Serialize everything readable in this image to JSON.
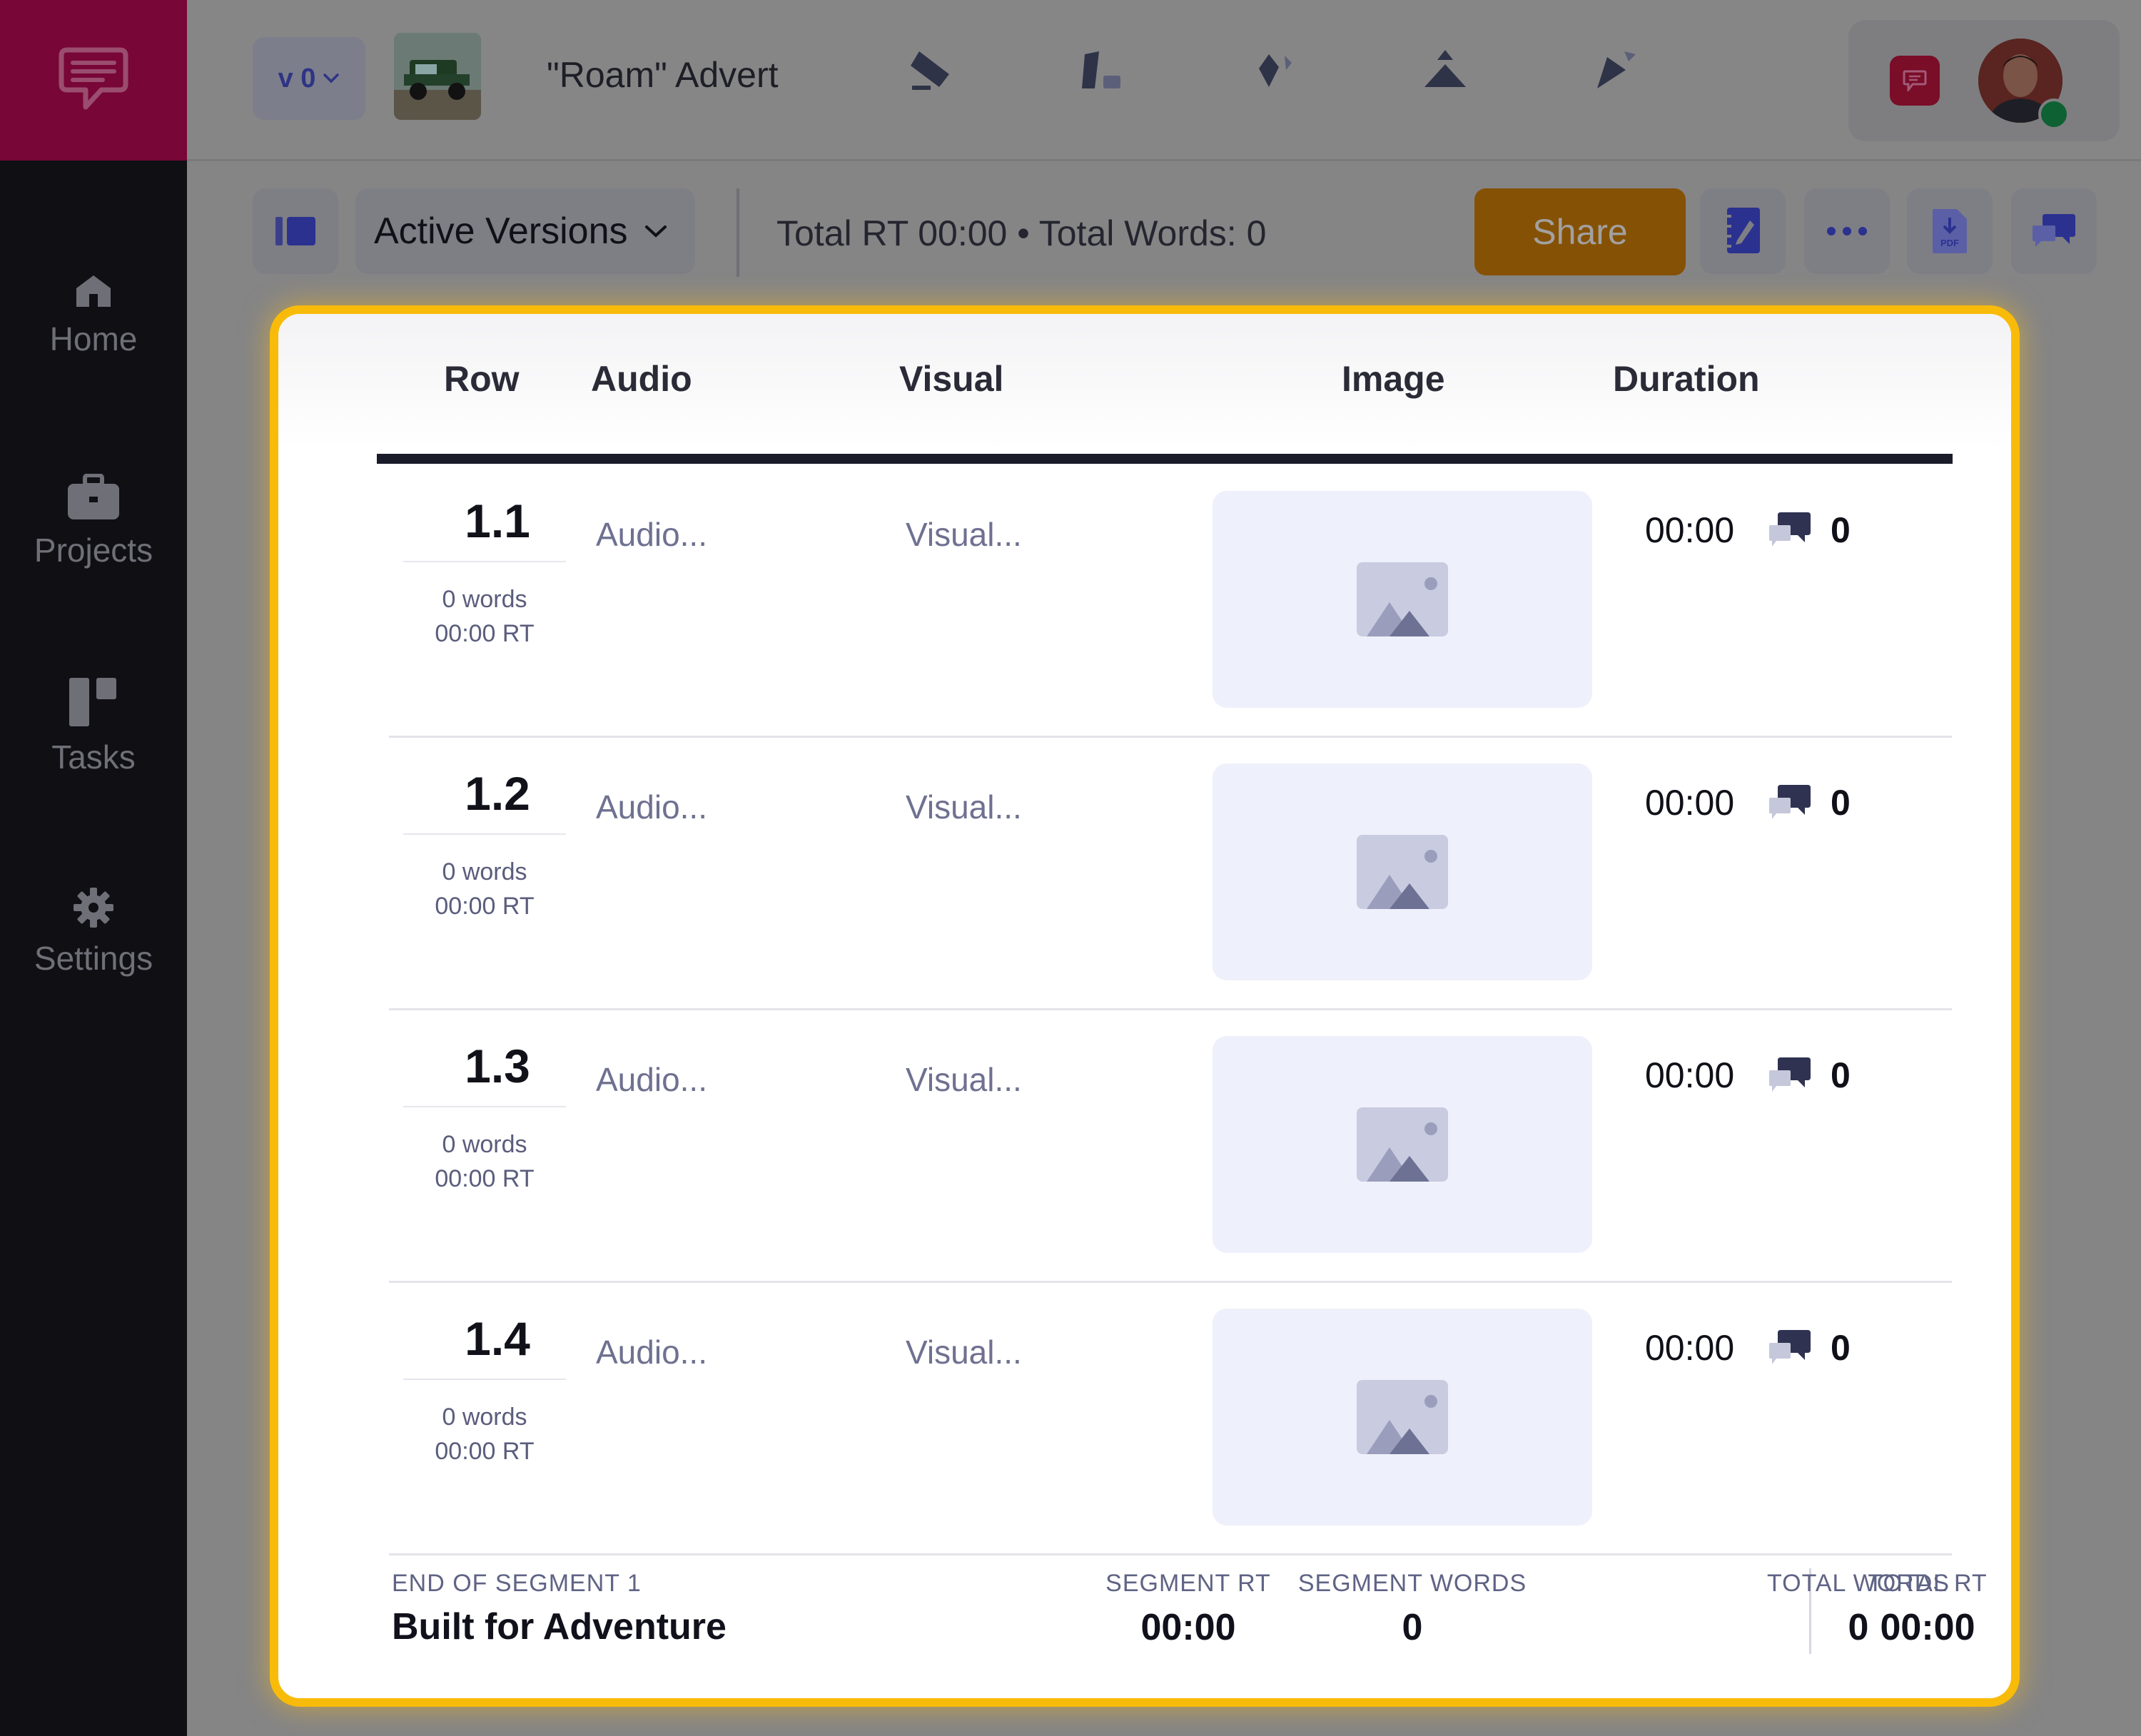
{
  "sidebar": {
    "items": [
      {
        "label": "Home"
      },
      {
        "label": "Projects"
      },
      {
        "label": "Tasks"
      },
      {
        "label": "Settings"
      }
    ]
  },
  "topbar": {
    "version_label": "v 0",
    "project_title": "\"Roam\" Advert"
  },
  "toolbar": {
    "versions_dropdown": "Active Versions",
    "totals": "Total RT 00:00 • Total Words: 0",
    "share_label": "Share"
  },
  "table": {
    "headers": [
      "Row",
      "Audio",
      "Visual",
      "Image",
      "Duration"
    ],
    "rows": [
      {
        "num": "1.1",
        "words": "0 words",
        "rt": "00:00 RT",
        "audio": "Audio...",
        "visual": "Visual...",
        "duration": "00:00",
        "comments": "0"
      },
      {
        "num": "1.2",
        "words": "0 words",
        "rt": "00:00 RT",
        "audio": "Audio...",
        "visual": "Visual...",
        "duration": "00:00",
        "comments": "0"
      },
      {
        "num": "1.3",
        "words": "0 words",
        "rt": "00:00 RT",
        "audio": "Audio...",
        "visual": "Visual...",
        "duration": "00:00",
        "comments": "0"
      },
      {
        "num": "1.4",
        "words": "0 words",
        "rt": "00:00 RT",
        "audio": "Audio...",
        "visual": "Visual...",
        "duration": "00:00",
        "comments": "0"
      }
    ]
  },
  "footer": {
    "segment_label": "END OF SEGMENT 1",
    "segment_name": "Built for Adventure",
    "segment_rt_label": "SEGMENT RT",
    "segment_rt": "00:00",
    "segment_words_label": "SEGMENT WORDS",
    "segment_words": "0",
    "total_rt_label": "TOTAL RT",
    "total_rt": "00:00",
    "total_words_label": "TOTAL WORDS",
    "total_words": "0"
  },
  "colors": {
    "brand": "#b3135a",
    "highlight_border": "#f9bb0a",
    "share": "#f09b07"
  }
}
